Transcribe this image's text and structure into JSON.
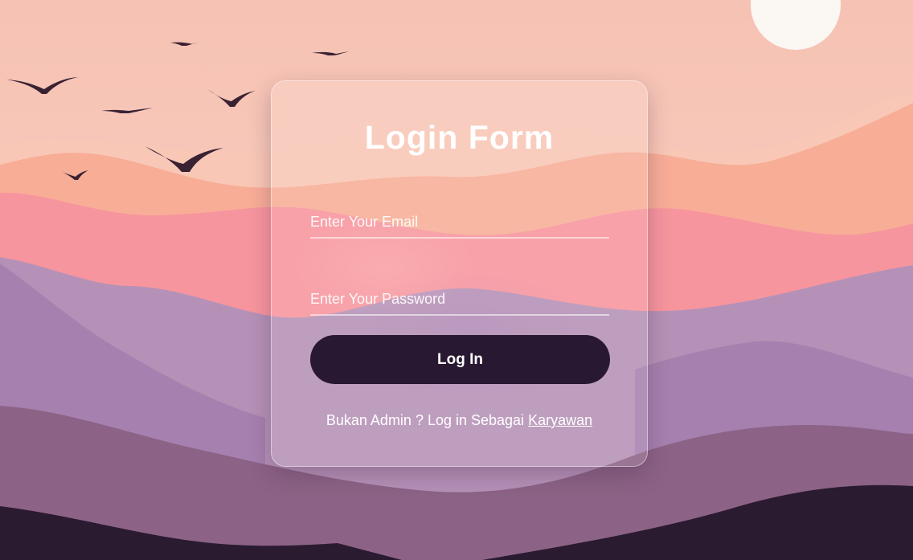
{
  "background": {
    "sky_top": "#f7c4b4",
    "sky_bottom": "#fad0c2",
    "sun": "#fbf7f3",
    "ridge_peach": "#f8ad97",
    "ridge_pink": "#f7959e",
    "ridge_lavender": "#b591b7",
    "ridge_violet": "#a681af",
    "ridge_mauve": "#8c6386",
    "ridge_dark": "#2b1b31",
    "bird_color": "#3a2233"
  },
  "login_form": {
    "title": "Login Form",
    "email": {
      "placeholder": "Enter Your Email",
      "value": ""
    },
    "password": {
      "placeholder": "Enter Your Password",
      "value": ""
    },
    "submit_label": "Log In",
    "footer_prefix": "Bukan Admin ? Log in Sebagai",
    "footer_link": "Karyawan",
    "button_color": "#291831"
  }
}
